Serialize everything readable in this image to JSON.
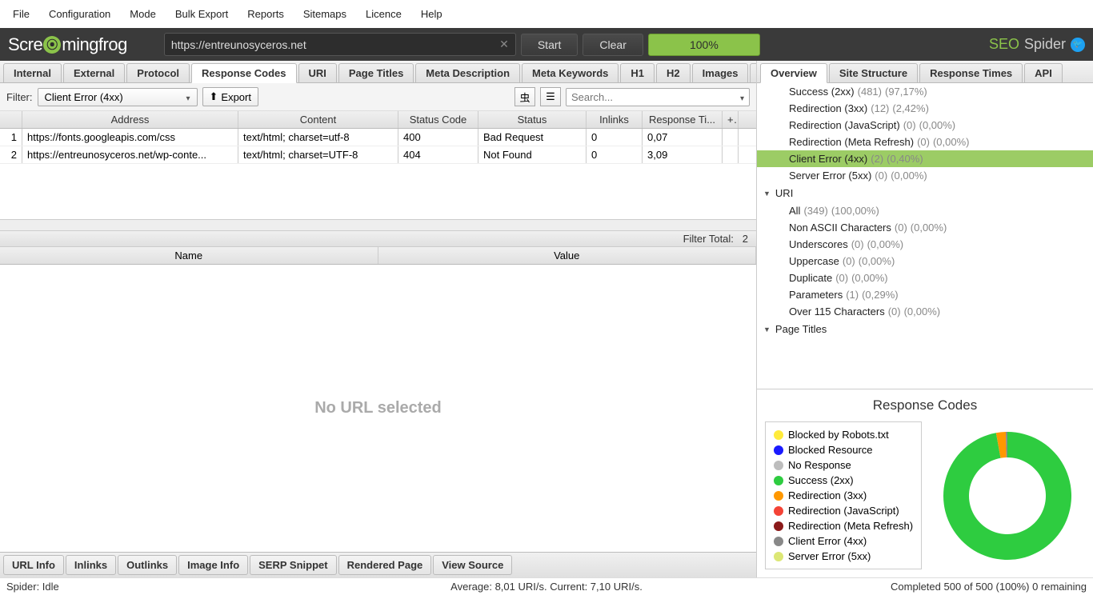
{
  "menu": [
    "File",
    "Configuration",
    "Mode",
    "Bulk Export",
    "Reports",
    "Sitemaps",
    "Licence",
    "Help"
  ],
  "toolbar": {
    "url": "https://entreunosyceros.net",
    "start": "Start",
    "clear": "Clear",
    "progress": "100%",
    "brand_seo": "SEO",
    "brand_spider": "Spider"
  },
  "main_tabs": [
    "Internal",
    "External",
    "Protocol",
    "Response Codes",
    "URI",
    "Page Titles",
    "Meta Description",
    "Meta Keywords",
    "H1",
    "H2",
    "Images"
  ],
  "main_tab_active": 3,
  "filter": {
    "label": "Filter:",
    "value": "Client Error (4xx)",
    "export": "Export",
    "search_placeholder": "Search..."
  },
  "grid": {
    "cols": [
      "Address",
      "Content",
      "Status Code",
      "Status",
      "Inlinks",
      "Response Ti..."
    ],
    "rows": [
      {
        "n": "1",
        "address": "https://fonts.googleapis.com/css",
        "content": "text/html; charset=utf-8",
        "code": "400",
        "status": "Bad Request",
        "inlinks": "0",
        "rt": "0,07"
      },
      {
        "n": "2",
        "address": "https://entreunosyceros.net/wp-conte...",
        "content": "text/html; charset=UTF-8",
        "code": "404",
        "status": "Not Found",
        "inlinks": "0",
        "rt": "3,09"
      }
    ],
    "filter_total_label": "Filter Total:",
    "filter_total_value": "2"
  },
  "kv": {
    "name": "Name",
    "value": "Value"
  },
  "detail_placeholder": "No URL selected",
  "bottom_tabs": [
    "URL Info",
    "Inlinks",
    "Outlinks",
    "Image Info",
    "SERP Snippet",
    "Rendered Page",
    "View Source"
  ],
  "status": {
    "left": "Spider: Idle",
    "center": "Average: 8,01 URI/s. Current: 7,10 URI/s.",
    "right": "Completed 500 of 500 (100%) 0 remaining"
  },
  "right_tabs": [
    "Overview",
    "Site Structure",
    "Response Times",
    "API"
  ],
  "right_tab_active": 0,
  "overview": [
    {
      "type": "item",
      "indent": true,
      "name": "Success (2xx)",
      "count": "(481)",
      "pct": "(97,17%)"
    },
    {
      "type": "item",
      "indent": true,
      "name": "Redirection (3xx)",
      "count": "(12)",
      "pct": "(2,42%)"
    },
    {
      "type": "item",
      "indent": true,
      "name": "Redirection (JavaScript)",
      "count": "(0)",
      "pct": "(0,00%)"
    },
    {
      "type": "item",
      "indent": true,
      "name": "Redirection (Meta Refresh)",
      "count": "(0)",
      "pct": "(0,00%)"
    },
    {
      "type": "item",
      "indent": true,
      "name": "Client Error (4xx)",
      "count": "(2)",
      "pct": "(0,40%)",
      "selected": true
    },
    {
      "type": "item",
      "indent": true,
      "name": "Server Error (5xx)",
      "count": "(0)",
      "pct": "(0,00%)"
    },
    {
      "type": "group",
      "name": "URI"
    },
    {
      "type": "item",
      "indent": true,
      "name": "All",
      "count": "(349)",
      "pct": "(100,00%)"
    },
    {
      "type": "item",
      "indent": true,
      "name": "Non ASCII Characters",
      "count": "(0)",
      "pct": "(0,00%)"
    },
    {
      "type": "item",
      "indent": true,
      "name": "Underscores",
      "count": "(0)",
      "pct": "(0,00%)"
    },
    {
      "type": "item",
      "indent": true,
      "name": "Uppercase",
      "count": "(0)",
      "pct": "(0,00%)"
    },
    {
      "type": "item",
      "indent": true,
      "name": "Duplicate",
      "count": "(0)",
      "pct": "(0,00%)"
    },
    {
      "type": "item",
      "indent": true,
      "name": "Parameters",
      "count": "(1)",
      "pct": "(0,29%)"
    },
    {
      "type": "item",
      "indent": true,
      "name": "Over 115 Characters",
      "count": "(0)",
      "pct": "(0,00%)"
    },
    {
      "type": "group",
      "name": "Page Titles"
    }
  ],
  "chart": {
    "title": "Response Codes",
    "legend": [
      {
        "color": "#ffeb3b",
        "label": "Blocked by Robots.txt"
      },
      {
        "color": "#1a1aff",
        "label": "Blocked Resource"
      },
      {
        "color": "#bdbdbd",
        "label": "No Response"
      },
      {
        "color": "#2ecc40",
        "label": "Success (2xx)"
      },
      {
        "color": "#ff9800",
        "label": "Redirection (3xx)"
      },
      {
        "color": "#f44336",
        "label": "Redirection (JavaScript)"
      },
      {
        "color": "#8b1a1a",
        "label": "Redirection (Meta Refresh)"
      },
      {
        "color": "#888888",
        "label": "Client Error (4xx)"
      },
      {
        "color": "#dce775",
        "label": "Server Error (5xx)"
      }
    ]
  },
  "chart_data": {
    "type": "pie",
    "title": "Response Codes",
    "series": [
      {
        "name": "Blocked by Robots.txt",
        "value": 0,
        "color": "#ffeb3b"
      },
      {
        "name": "Blocked Resource",
        "value": 0,
        "color": "#1a1aff"
      },
      {
        "name": "No Response",
        "value": 0,
        "color": "#bdbdbd"
      },
      {
        "name": "Success (2xx)",
        "value": 481,
        "color": "#2ecc40"
      },
      {
        "name": "Redirection (3xx)",
        "value": 12,
        "color": "#ff9800"
      },
      {
        "name": "Redirection (JavaScript)",
        "value": 0,
        "color": "#f44336"
      },
      {
        "name": "Redirection (Meta Refresh)",
        "value": 0,
        "color": "#8b1a1a"
      },
      {
        "name": "Client Error (4xx)",
        "value": 2,
        "color": "#888888"
      },
      {
        "name": "Server Error (5xx)",
        "value": 0,
        "color": "#dce775"
      }
    ]
  }
}
